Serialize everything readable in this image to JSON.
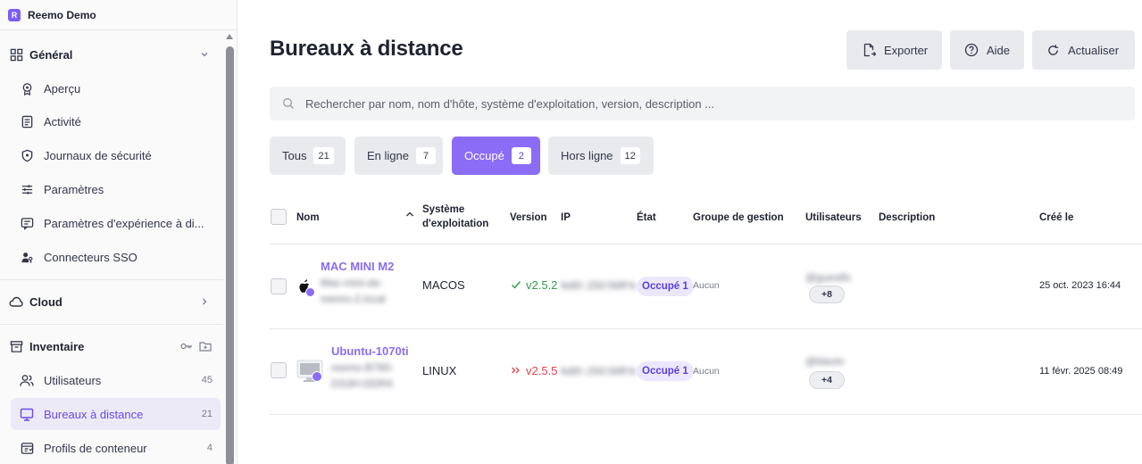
{
  "app": {
    "name": "Reemo Demo"
  },
  "sidebar": {
    "general": {
      "title": "Général",
      "items": [
        {
          "label": "Aperçu"
        },
        {
          "label": "Activité"
        },
        {
          "label": "Journaux de sécurité"
        },
        {
          "label": "Paramètres"
        },
        {
          "label": "Paramètres d'expérience à di..."
        },
        {
          "label": "Connecteurs SSO"
        }
      ]
    },
    "cloud": {
      "title": "Cloud"
    },
    "inventory": {
      "title": "Inventaire",
      "items": [
        {
          "label": "Utilisateurs",
          "count": "45"
        },
        {
          "label": "Bureaux à distance",
          "count": "21"
        },
        {
          "label": "Profils de conteneur",
          "count": "4"
        }
      ]
    }
  },
  "header": {
    "title": "Bureaux à distance",
    "export_label": "Exporter",
    "help_label": "Aide",
    "refresh_label": "Actualiser"
  },
  "search": {
    "placeholder": "Rechercher par nom, nom d'hôte, système d'exploitation, version, description ..."
  },
  "filters": [
    {
      "label": "Tous",
      "count": "21"
    },
    {
      "label": "En ligne",
      "count": "7"
    },
    {
      "label": "Occupé",
      "count": "2"
    },
    {
      "label": "Hors ligne",
      "count": "12"
    }
  ],
  "table": {
    "columns": {
      "name": "Nom",
      "os_line1": "Système",
      "os_line2": "d'exploitation",
      "version": "Version",
      "ip": "IP",
      "state": "État",
      "group": "Groupe de gestion",
      "users": "Utilisateurs",
      "description": "Description",
      "created": "Créé le"
    },
    "rows": [
      {
        "name": "MAC MINI M2",
        "host_line1": "Mac-mini-de-",
        "host_line2": "reemo-2.local",
        "os": "MACOS",
        "version": "v2.5.2",
        "ip": "fe80::250:56ff:fe",
        "state": "Occupé 1",
        "group": "Aucun",
        "user": "@guestfs",
        "more_users": "+8",
        "created": "25 oct. 2023 16:44"
      },
      {
        "name": "Ubuntu-1070ti",
        "host_line1": "reemo-B760-",
        "host_line2": "DS3H-DDR4",
        "os": "LINUX",
        "version": "v2.5.5",
        "ip": "fe80::250:56ff:fe",
        "state": "Occupé 1",
        "group": "Aucun",
        "user": "@blavin",
        "more_users": "+4",
        "created": "11 févr. 2025 08:49"
      }
    ]
  },
  "colors": {
    "accent": "#8b6cf6",
    "ok": "#2e9c4a",
    "error": "#e0434f"
  }
}
